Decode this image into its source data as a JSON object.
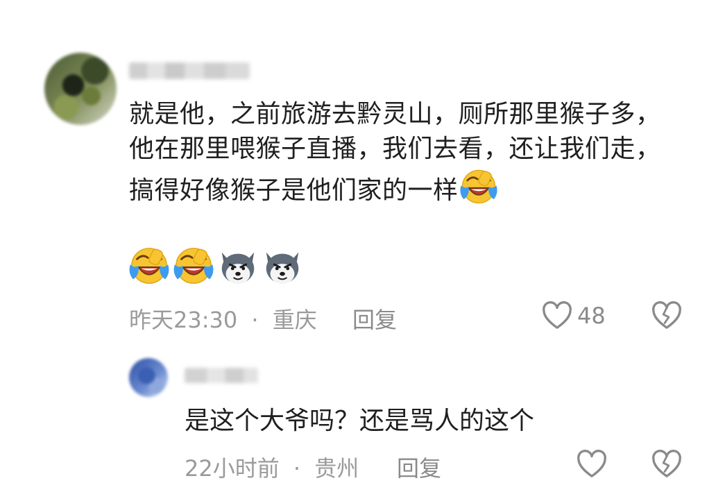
{
  "comment": {
    "text": "就是他，之前旅游去黔灵山，厕所那里猴子多，他在那里喂猴子直播，我们去看，还让我们走，搞得好像猴子是他们家的一样",
    "emojis": [
      "laughing-crying-emoji",
      "laughing-crying-emoji",
      "laughing-crying-emoji",
      "husky-dog-emoji",
      "husky-dog-emoji"
    ],
    "time": "昨天23:30",
    "separator": "·",
    "location": "重庆",
    "reply_label": "回复",
    "like_count": "48",
    "like_icon": "heart-outline-icon",
    "dislike_icon": "broken-heart-icon"
  },
  "reply": {
    "text": "是这个大爷吗？还是骂人的这个",
    "time": "22小时前",
    "separator": "·",
    "location": "贵州",
    "reply_label": "回复",
    "like_icon": "heart-outline-icon",
    "dislike_icon": "broken-heart-icon"
  },
  "colors": {
    "text": "#1f1f1f",
    "meta": "#9a9a9a",
    "icon": "#8a8a8a",
    "emoji_yellow": "#f7c531",
    "emoji_tears": "#3d9bf0"
  }
}
